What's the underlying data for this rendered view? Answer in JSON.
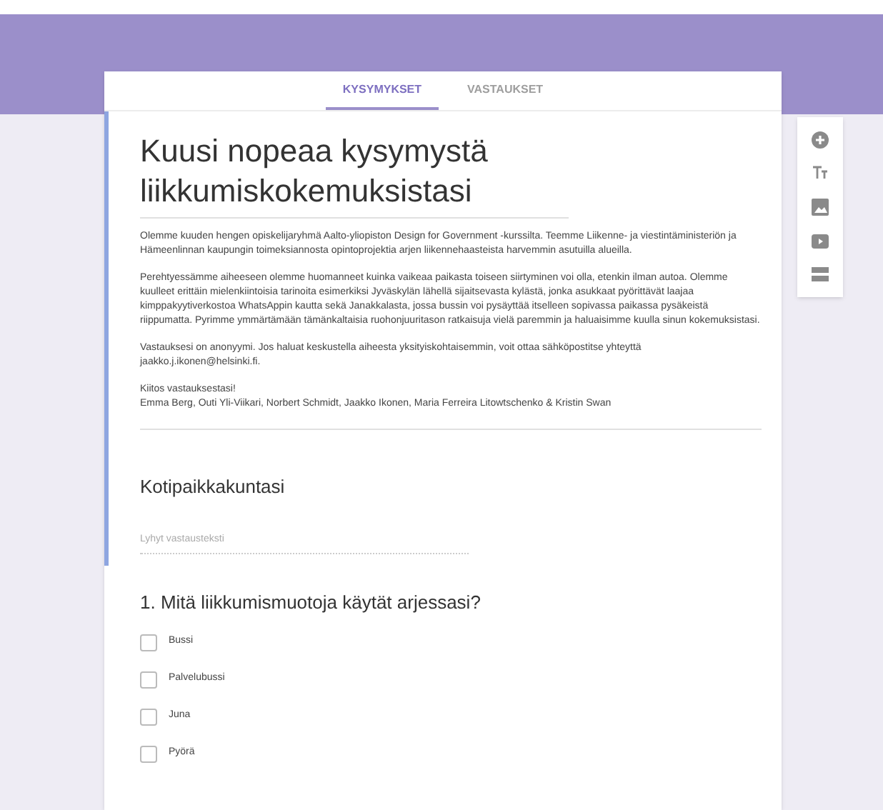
{
  "tabs": [
    {
      "label": "KYSYMYKSET",
      "selected": true
    },
    {
      "label": "VASTAUKSET",
      "selected": false
    }
  ],
  "form": {
    "title": "Kuusi nopeaa kysymystä liikkumiskokemuksistasi",
    "description": [
      [
        "Olemme kuuden hengen opiskelijaryhmä Aalto-yliopiston Design for Government -kurssilta. Teemme Liikenne- ja viestintäministeriön ja Hämeenlinnan kaupungin toimeksiannosta opintoprojektia arjen liikennehaasteista harvemmin asutuilla alueilla."
      ],
      [
        "Perehtyessämme aiheeseen olemme huomanneet kuinka vaikeaa paikasta toiseen siirtyminen voi olla, etenkin ilman autoa. Olemme kuulleet erittäin mielenkiintoisia tarinoita esimerkiksi Jyväskylän lähellä sijaitsevasta kylästä, jonka asukkaat pyörittävät laajaa kimppakyytiverkostoa WhatsAppin kautta sekä Janakkalasta, jossa bussin voi pysäyttää itselleen sopivassa paikassa pysäkeistä riippumatta. Pyrimme ymmärtämään tämänkaltaisia ruohonjuuritason ratkaisuja vielä paremmin ja haluaisimme kuulla sinun kokemuksistasi."
      ],
      [
        "Vastauksesi on anonyymi. Jos haluat keskustella aiheesta yksityiskohtaisemmin, voit ottaa sähköpostitse yhteyttä jaakko.j.ikonen@helsinki.fi."
      ],
      [
        "Kiitos vastauksestasi!",
        "Emma Berg, Outi Yli-Viikari, Norbert Schmidt, Jaakko Ikonen, Maria Ferreira Litowtschenko & Kristin Swan"
      ]
    ]
  },
  "questions": [
    {
      "kind": "text",
      "title": "Kotipaikkakuntasi",
      "placeholder": "Lyhyt vastausteksti",
      "selected": true
    },
    {
      "kind": "checkbox",
      "title": "1. Mitä liikkumismuotoja käytät arjessasi?",
      "selected": false,
      "options": [
        {
          "label": "Bussi",
          "checked": false
        },
        {
          "label": "Palvelubussi",
          "checked": false
        },
        {
          "label": "Juna",
          "checked": false
        },
        {
          "label": "Pyörä",
          "checked": false
        }
      ]
    }
  ]
}
